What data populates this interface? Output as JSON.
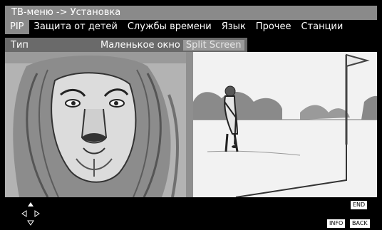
{
  "header": {
    "title": "ТВ-меню -> Установка"
  },
  "tabs": [
    {
      "label": "PIP",
      "active": true
    },
    {
      "label": "Защита от детей",
      "active": false
    },
    {
      "label": "Службы времени",
      "active": false
    },
    {
      "label": "Язык",
      "active": false
    },
    {
      "label": "Прочее",
      "active": false
    },
    {
      "label": "Станции",
      "active": false
    }
  ],
  "option": {
    "label": "Тип",
    "values": [
      {
        "label": "Маленькое окно",
        "selected": true
      },
      {
        "label": "Split Screen",
        "selected": false
      }
    ]
  },
  "buttons": {
    "end": "END",
    "info": "INFO",
    "back": "BACK"
  },
  "icons": {
    "navigation": "directional-pad-icon"
  },
  "colors": {
    "title_bar": "#8a8a8a",
    "active_tab": "#8a8a8a",
    "option_row": "#6a6a6a",
    "inactive_value": "#9a9a9a"
  }
}
